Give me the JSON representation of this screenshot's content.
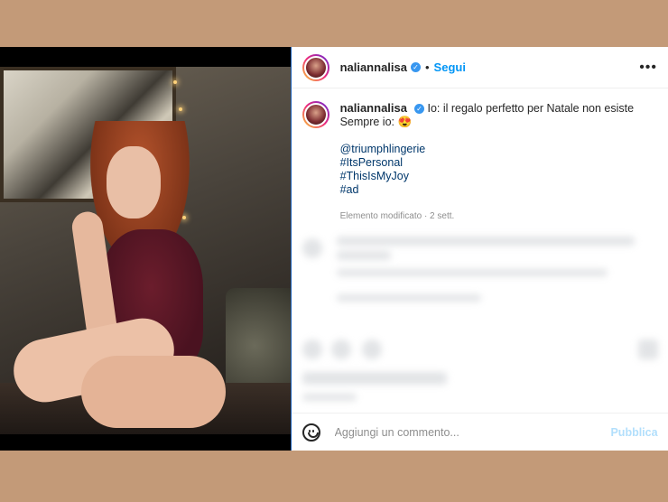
{
  "post": {
    "username": "naliannalisa",
    "follow_label": "Segui",
    "separator": "•",
    "more_label": "•••",
    "caption_line1": "Io: il regalo perfetto per Natale non esiste",
    "caption_line2": "Sempre io: 😍",
    "tags": [
      "@triumphlingerie",
      "#ItsPersonal",
      "#ThisIsMyJoy",
      "#ad"
    ],
    "meta": "Elemento modificato · 2 sett."
  },
  "footer": {
    "comment_placeholder": "Aggiungi un commento...",
    "publish_label": "Pubblica"
  },
  "colors": {
    "accent": "#0095f6",
    "link": "#00376b",
    "publish_disabled": "#b2dffc",
    "background": "#c39a78"
  },
  "icons": [
    "verified-badge-icon",
    "more-options-icon",
    "emoji-icon"
  ]
}
